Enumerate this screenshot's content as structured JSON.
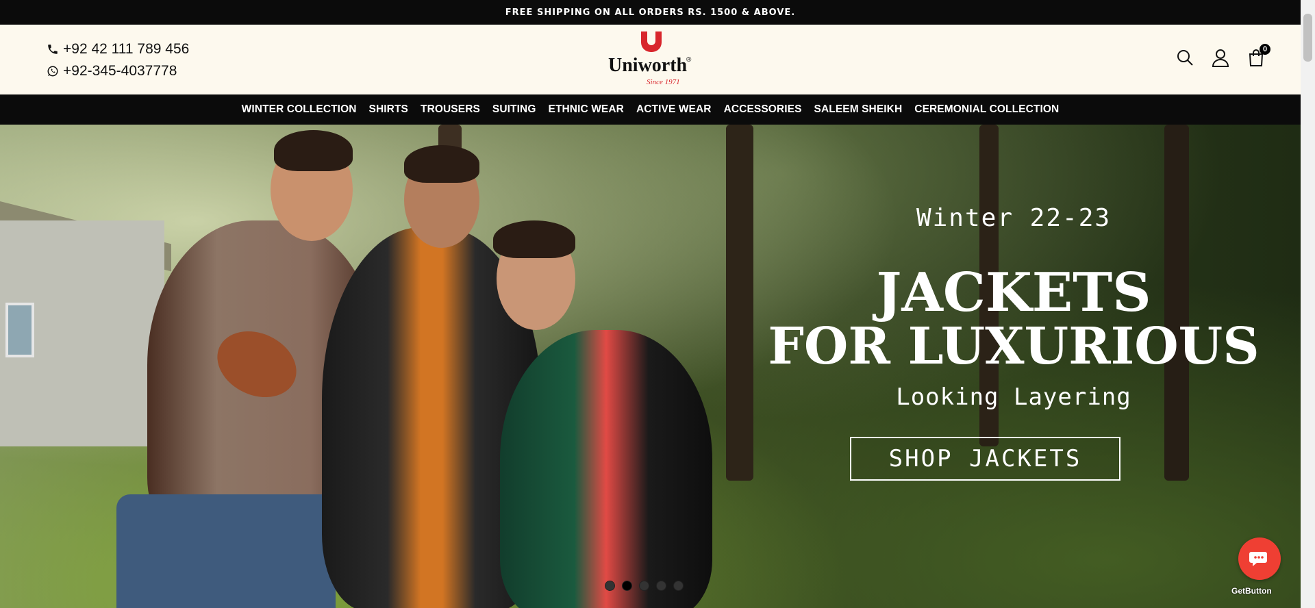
{
  "announcement": "FREE SHIPPING ON ALL ORDERS RS. 1500 & ABOVE.",
  "contact": {
    "phone": "+92 42 111 789 456",
    "whatsapp": "+92-345-4037778"
  },
  "logo": {
    "word": "Uniworth",
    "since": "Since 1971",
    "reg": "®"
  },
  "header_icons": [
    "search-icon",
    "user-icon",
    "cart-icon"
  ],
  "cart_count": "0",
  "nav": [
    "WINTER COLLECTION",
    "SHIRTS",
    "TROUSERS",
    "SUITING",
    "ETHNIC WEAR",
    "ACTIVE WEAR",
    "ACCESSORIES",
    "SALEEM SHEIKH",
    "CEREMONIAL COLLECTION"
  ],
  "hero": {
    "season": "Winter 22-23",
    "title_line1": "JACKETS",
    "title_line2": "FOR LUXURIOUS",
    "subtitle": "Looking Layering",
    "cta": "SHOP JACKETS",
    "slides_total": 5,
    "active_slide": 2
  },
  "widget": {
    "label": "GetButton"
  },
  "colors": {
    "brand_red": "#d8262c",
    "header_bg": "#fdf9ee",
    "nav_bg": "#0b0b0b",
    "chat_red": "#ef3f33"
  }
}
